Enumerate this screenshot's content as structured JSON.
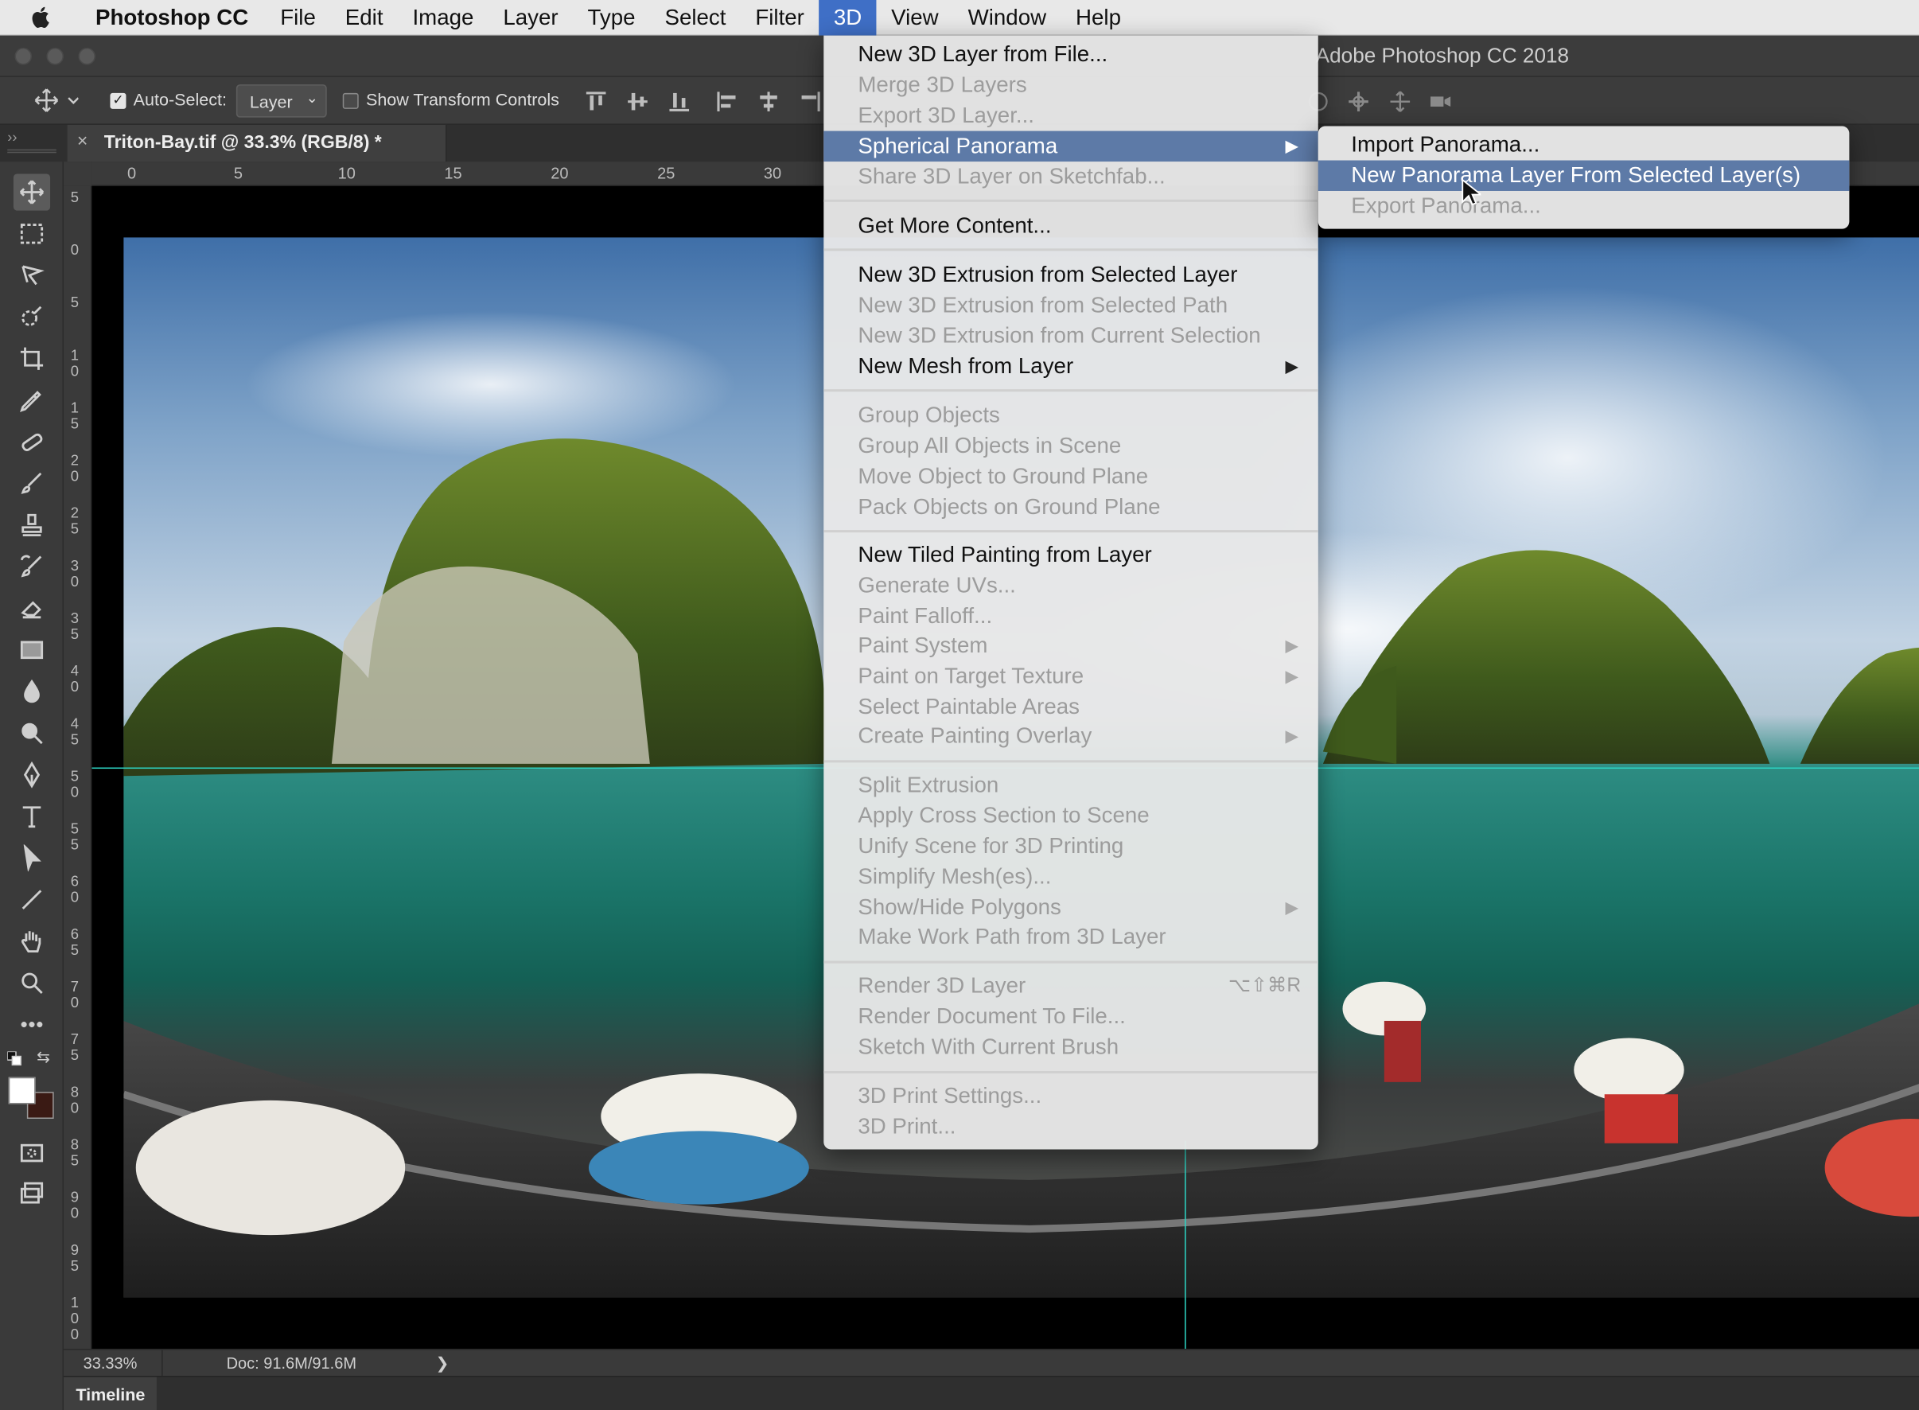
{
  "menubar": {
    "app_name": "Photoshop CC",
    "items": [
      "File",
      "Edit",
      "Image",
      "Layer",
      "Type",
      "Select",
      "Filter",
      "3D",
      "View",
      "Window",
      "Help"
    ],
    "active": "3D"
  },
  "window": {
    "title": "Adobe Photoshop CC 2018"
  },
  "options_bar": {
    "auto_select_label": "Auto-Select:",
    "auto_select_checked": true,
    "auto_select_value": "Layer",
    "show_transform_label": "Show Transform Controls",
    "show_transform_checked": false
  },
  "document_tab": {
    "close": "×",
    "title": "Triton-Bay.tif @ 33.3% (RGB/8) *"
  },
  "ruler_top": [
    "0",
    "5",
    "10",
    "15",
    "20",
    "25",
    "30"
  ],
  "ruler_left": [
    "5",
    "0",
    "5",
    "1\n0",
    "1\n5",
    "2\n0",
    "2\n5",
    "3\n0",
    "3\n5",
    "4\n0",
    "4\n5",
    "5\n0",
    "5\n5",
    "6\n0",
    "6\n5",
    "7\n0",
    "7\n5",
    "8\n0",
    "8\n5",
    "9\n0",
    "9\n5",
    "1\n0\n0"
  ],
  "status": {
    "zoom": "33.33%",
    "doc": "Doc: 91.6M/91.6M",
    "arrow": "❯"
  },
  "timeline": {
    "label": "Timeline"
  },
  "menu_3d": {
    "items": [
      {
        "label": "New 3D Layer from File...",
        "enabled": true
      },
      {
        "label": "Merge 3D Layers",
        "enabled": false
      },
      {
        "label": "Export 3D Layer...",
        "enabled": false
      },
      {
        "label": "Spherical Panorama",
        "enabled": true,
        "submenu": true,
        "highlighted": true
      },
      {
        "label": "Share 3D Layer on Sketchfab...",
        "enabled": false
      },
      {
        "label": "Get More Content...",
        "enabled": true
      },
      {
        "label": "New 3D Extrusion from Selected Layer",
        "enabled": true
      },
      {
        "label": "New 3D Extrusion from Selected Path",
        "enabled": false
      },
      {
        "label": "New 3D Extrusion from Current Selection",
        "enabled": false
      },
      {
        "label": "New Mesh from Layer",
        "enabled": true,
        "submenu": true
      },
      {
        "label": "Group Objects",
        "enabled": false
      },
      {
        "label": "Group All Objects in Scene",
        "enabled": false
      },
      {
        "label": "Move Object to Ground Plane",
        "enabled": false
      },
      {
        "label": "Pack Objects on Ground Plane",
        "enabled": false
      },
      {
        "label": "New Tiled Painting from Layer",
        "enabled": true
      },
      {
        "label": "Generate UVs...",
        "enabled": false
      },
      {
        "label": "Paint Falloff...",
        "enabled": false
      },
      {
        "label": "Paint System",
        "enabled": false,
        "submenu": true
      },
      {
        "label": "Paint on Target Texture",
        "enabled": false,
        "submenu": true
      },
      {
        "label": "Select Paintable Areas",
        "enabled": false
      },
      {
        "label": "Create Painting Overlay",
        "enabled": false,
        "submenu": true
      },
      {
        "label": "Split Extrusion",
        "enabled": false
      },
      {
        "label": "Apply Cross Section to Scene",
        "enabled": false
      },
      {
        "label": "Unify Scene for 3D Printing",
        "enabled": false
      },
      {
        "label": "Simplify Mesh(es)...",
        "enabled": false
      },
      {
        "label": "Show/Hide Polygons",
        "enabled": false,
        "submenu": true
      },
      {
        "label": "Make Work Path from 3D Layer",
        "enabled": false
      },
      {
        "label": "Render 3D Layer",
        "enabled": false,
        "shortcut": "⌥⇧⌘R"
      },
      {
        "label": "Render Document To File...",
        "enabled": false
      },
      {
        "label": "Sketch With Current Brush",
        "enabled": false
      },
      {
        "label": "3D Print Settings...",
        "enabled": false
      },
      {
        "label": "3D Print...",
        "enabled": false
      }
    ]
  },
  "submenu_panorama": {
    "items": [
      {
        "label": "Import Panorama...",
        "enabled": true
      },
      {
        "label": "New Panorama Layer From Selected Layer(s)",
        "enabled": true,
        "highlighted": true
      },
      {
        "label": "Export Panorama...",
        "enabled": false
      }
    ]
  },
  "colors": {
    "menu_highlight": "#5d7aa7",
    "menubar_active": "#3f6fc6",
    "guide": "#2dd3c3"
  }
}
